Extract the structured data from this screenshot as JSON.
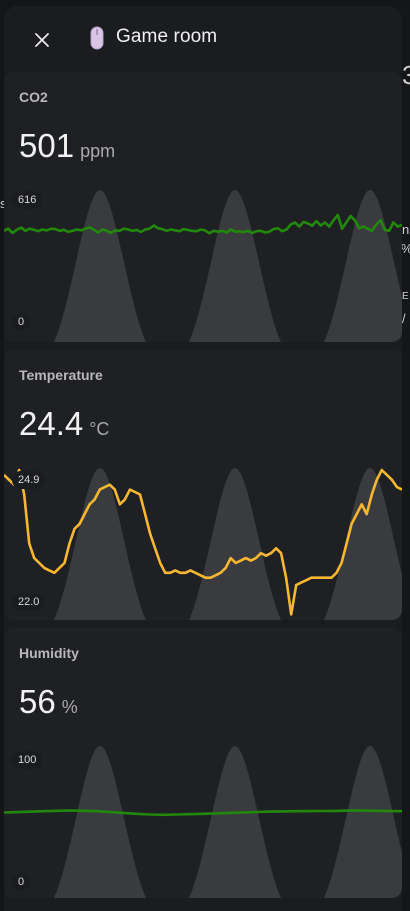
{
  "header": {
    "title": "Game room",
    "close_icon": "close-icon",
    "room_icon": "computer-mouse-icon"
  },
  "background_fragments": [
    "3",
    "s",
    "n",
    "%",
    "E",
    "/"
  ],
  "cards": [
    {
      "label": "CO2",
      "value": "501",
      "unit": "ppm",
      "y_max_label": "616",
      "y_min_label": "0",
      "line_color": "#22880b",
      "chart_data": {
        "type": "line",
        "ylim": [
          0,
          616
        ],
        "values": [
          470,
          480,
          460,
          475,
          485,
          470,
          480,
          475,
          468,
          476,
          472,
          480,
          478,
          470,
          475,
          465,
          470,
          476,
          472,
          480,
          486,
          475,
          462,
          476,
          470,
          460,
          472,
          470,
          480,
          476,
          470,
          474,
          465,
          476,
          480,
          495,
          482,
          478,
          470,
          476,
          472,
          468,
          478,
          474,
          470,
          468,
          476,
          472,
          458,
          470,
          466,
          470,
          462,
          476,
          466,
          468,
          464,
          470,
          460,
          468,
          470,
          462,
          466,
          478,
          482,
          468,
          476,
          500,
          510,
          490,
          512,
          505,
          494,
          516,
          495,
          510,
          490,
          520,
          545,
          480,
          510,
          540,
          520,
          482,
          490,
          480,
          470,
          500,
          520,
          475,
          470,
          510,
          490,
          498
        ]
      }
    },
    {
      "label": "Temperature",
      "value": "24.4",
      "unit": "°C",
      "y_max_label": "24.9",
      "y_min_label": "22.0",
      "line_color": "#f7b731",
      "chart_data": {
        "type": "line",
        "ylim": [
          22.0,
          24.9
        ],
        "values": [
          24.8,
          24.7,
          24.6,
          24.9,
          24.4,
          23.4,
          23.1,
          23.0,
          22.9,
          22.85,
          22.8,
          22.9,
          23.0,
          23.4,
          23.7,
          23.8,
          24.0,
          24.2,
          24.3,
          24.5,
          24.55,
          24.6,
          24.5,
          24.2,
          24.3,
          24.5,
          24.45,
          24.4,
          24.0,
          23.6,
          23.3,
          23.0,
          22.8,
          22.8,
          22.85,
          22.8,
          22.8,
          22.85,
          22.8,
          22.75,
          22.7,
          22.7,
          22.75,
          22.8,
          22.9,
          23.1,
          23.0,
          23.05,
          23.1,
          23.05,
          23.1,
          23.2,
          23.15,
          23.2,
          23.3,
          23.2,
          22.7,
          21.95,
          22.55,
          22.6,
          22.65,
          22.7,
          22.7,
          22.7,
          22.7,
          22.7,
          22.8,
          23.0,
          23.4,
          23.8,
          24.0,
          24.2,
          24.0,
          24.4,
          24.7,
          24.9,
          24.8,
          24.7,
          24.55,
          24.5
        ]
      }
    },
    {
      "label": "Humidity",
      "value": "56",
      "unit": "%",
      "y_max_label": "100",
      "y_min_label": "0",
      "line_color": "#22880b",
      "chart_data": {
        "type": "line",
        "ylim": [
          0,
          100
        ],
        "values": [
          57,
          57.3,
          57.6,
          58,
          58.4,
          58.6,
          58.4,
          58,
          57.3,
          56.6,
          55.9,
          55.3,
          55.1,
          55.3,
          55.6,
          55.9,
          56.2,
          56.6,
          57,
          57.4,
          57.7,
          57.9,
          58,
          58.1,
          58.2,
          58.3,
          58.5,
          58.6,
          58.4,
          58.2,
          58
        ]
      }
    }
  ]
}
